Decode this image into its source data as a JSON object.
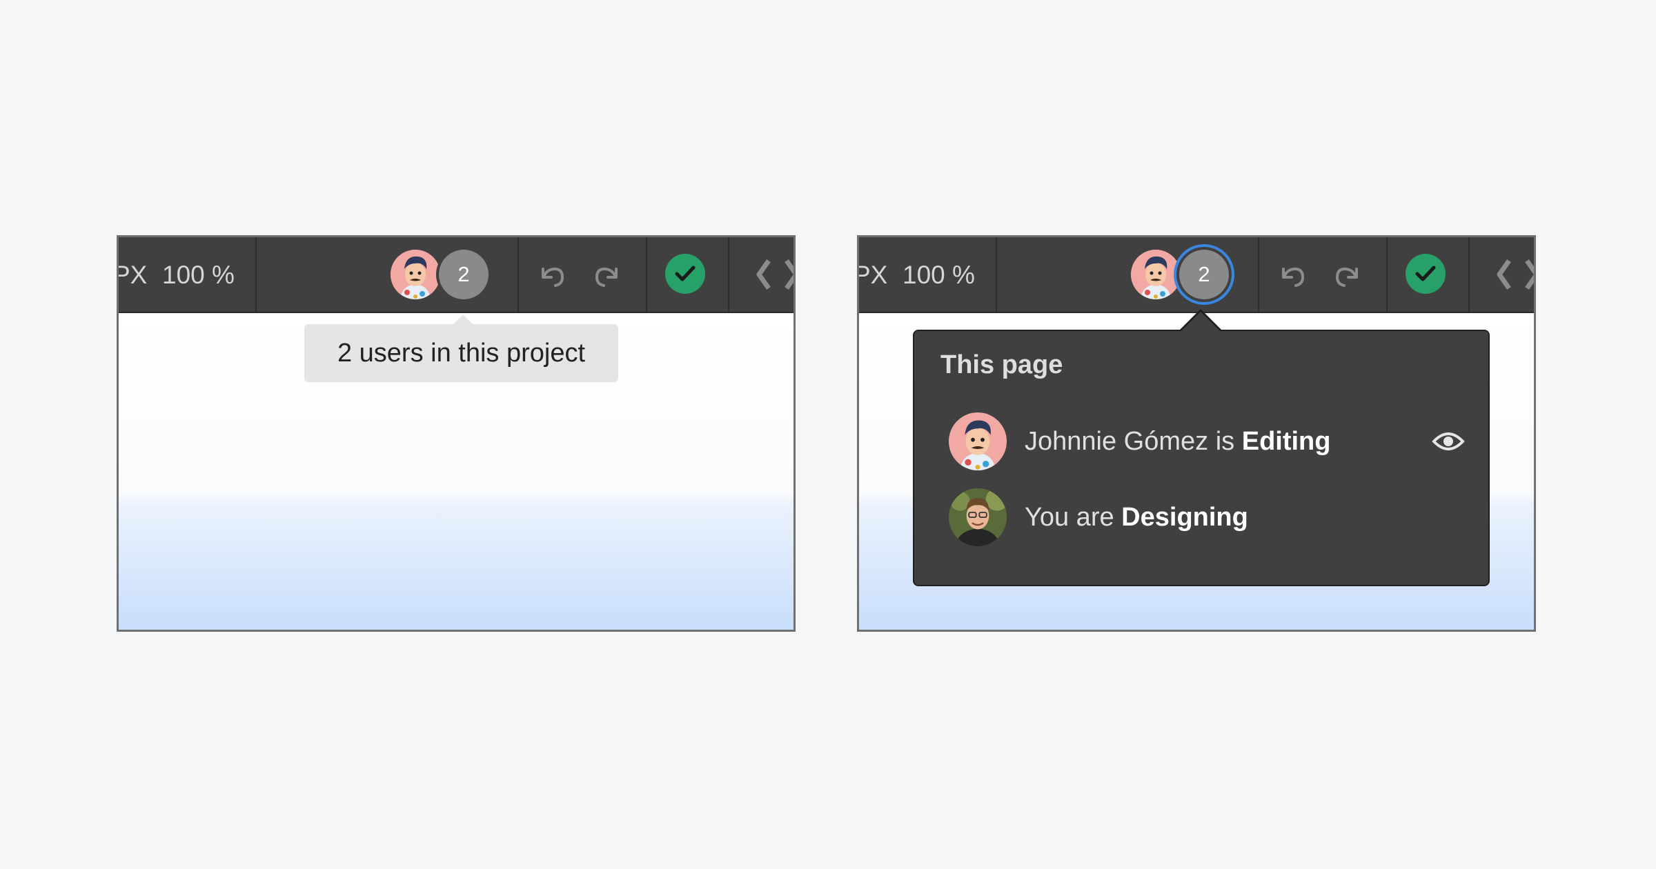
{
  "colors": {
    "page_background": "#f5f6f8",
    "toolbar_background": "#404040",
    "success_green": "#27a167",
    "focus_ring_blue": "#3b86e0",
    "badge_gray": "#8a8a8a",
    "tooltip_background": "#e5e5e5"
  },
  "left_panel": {
    "toolbar": {
      "unit_label": "PX",
      "zoom_label": "100 %",
      "user_count": "2",
      "icons": [
        "avatar",
        "undo-icon",
        "redo-icon",
        "check-icon",
        "code-icon"
      ]
    },
    "tooltip": {
      "text": "2 users in this project"
    }
  },
  "right_panel": {
    "toolbar": {
      "unit_label": "PX",
      "zoom_label": "100 %",
      "user_count": "2",
      "icons": [
        "avatar",
        "undo-icon",
        "redo-icon",
        "check-icon",
        "code-icon"
      ]
    },
    "popover": {
      "title": "This page",
      "users": [
        {
          "name_text": "Johnnie Gómez is ",
          "status": "Editing",
          "icon": "eye-icon"
        },
        {
          "name_text": "You are ",
          "status": "Designing"
        }
      ]
    }
  }
}
